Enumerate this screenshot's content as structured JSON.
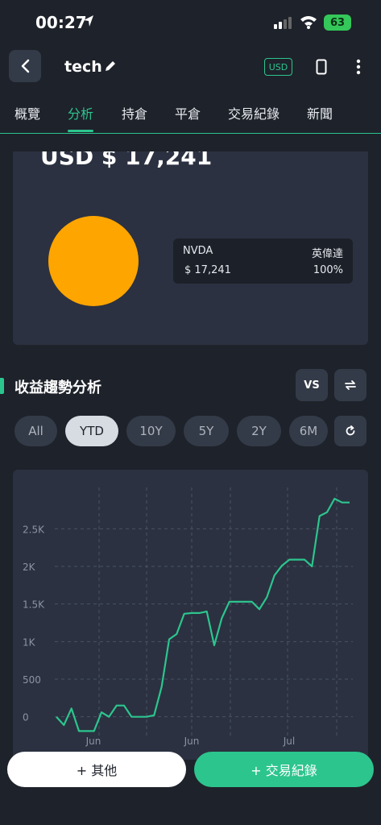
{
  "status": {
    "time": "00:27",
    "battery": "63"
  },
  "header": {
    "title": "tech",
    "currency_badge": "USD"
  },
  "tabs": [
    {
      "label": "概覽"
    },
    {
      "label": "分析",
      "active": true
    },
    {
      "label": "持倉"
    },
    {
      "label": "平倉"
    },
    {
      "label": "交易紀錄"
    },
    {
      "label": "新聞"
    }
  ],
  "allocation": {
    "total": "USD  $ 17,241",
    "pie_color": "#ffa500",
    "legend": {
      "symbol": "NVDA",
      "name": "英偉達",
      "value": "$ 17,241",
      "percent": "100%"
    }
  },
  "trend": {
    "title": "收益趨勢分析",
    "vs_label": "VS",
    "ranges": [
      "All",
      "YTD",
      "10Y",
      "5Y",
      "2Y",
      "6M"
    ],
    "active_range": "YTD"
  },
  "chart_data": {
    "type": "line",
    "x_labels": [
      "Jun",
      "Jun",
      "Jul"
    ],
    "y_ticks": [
      "2.5K",
      "2K",
      "1.5K",
      "1K",
      "500",
      "0"
    ],
    "ylim": [
      -250,
      3050
    ],
    "line_color": "#2cc58e",
    "grid": true,
    "series": [
      {
        "values": [
          0,
          -110,
          110,
          -190,
          -190,
          -190,
          60,
          0,
          150,
          150,
          0,
          0,
          0,
          20,
          400,
          1030,
          1100,
          1370,
          1380,
          1380,
          1400,
          950,
          1310,
          1530,
          1530,
          1530,
          1530,
          1430,
          1590,
          1880,
          2010,
          2090,
          2090,
          2090,
          2000,
          2670,
          2720,
          2900,
          2850,
          2850
        ]
      }
    ]
  },
  "actions": {
    "other": "+ 其他",
    "trade": "+ 交易紀錄"
  },
  "colors": {
    "accent": "#2cc58e",
    "background": "#1e222a",
    "card": "#2b3140"
  }
}
